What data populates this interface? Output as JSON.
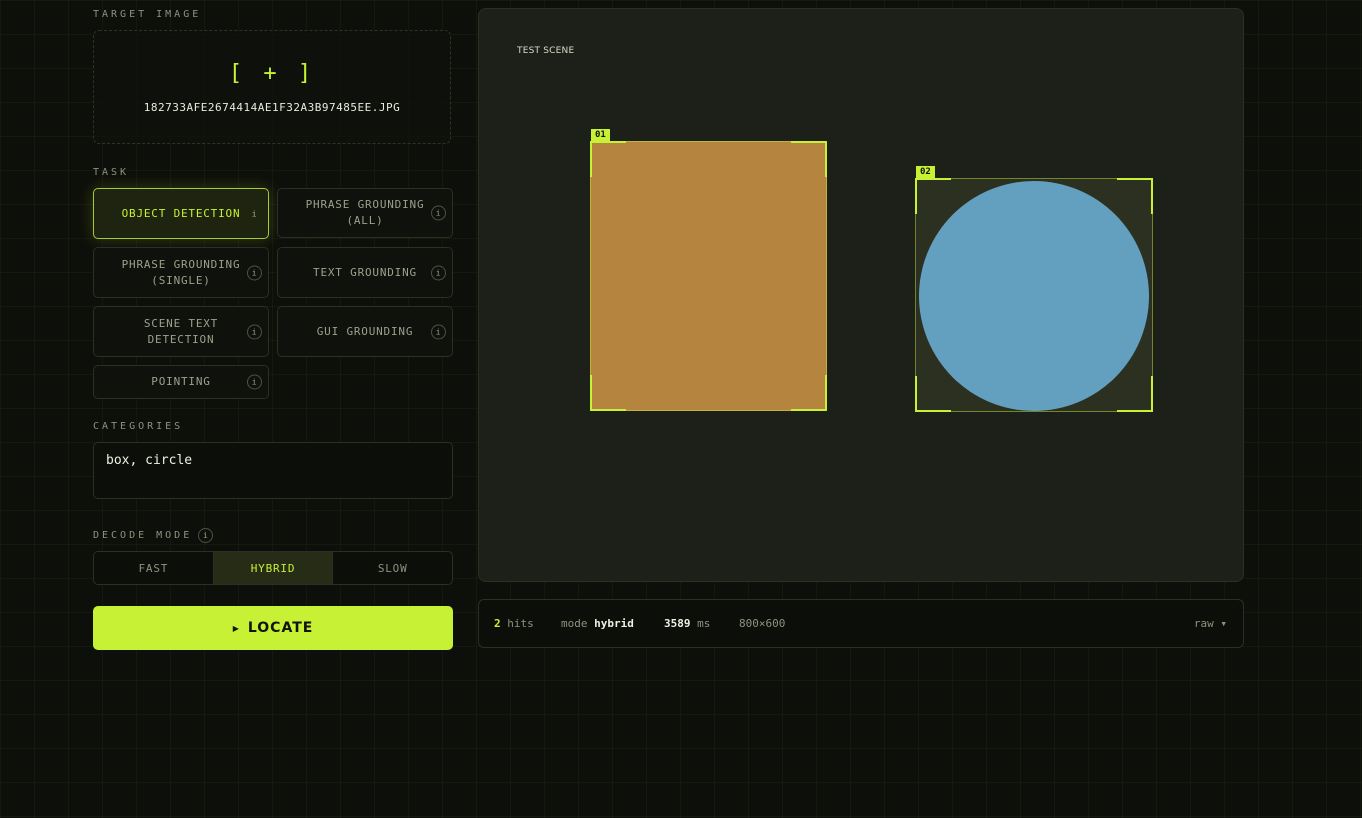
{
  "upload": {
    "label": "TARGET IMAGE",
    "icon": "[ + ]",
    "filename": "182733AFE2674414AE1F32A3B97485EE.JPG"
  },
  "task": {
    "label": "TASK",
    "options": [
      {
        "label": "OBJECT DETECTION",
        "active": true
      },
      {
        "label": "PHRASE GROUNDING (ALL)",
        "active": false
      },
      {
        "label": "PHRASE GROUNDING (SINGLE)",
        "active": false
      },
      {
        "label": "TEXT GROUNDING",
        "active": false
      },
      {
        "label": "SCENE TEXT DETECTION",
        "active": false
      },
      {
        "label": "GUI GROUNDING",
        "active": false
      },
      {
        "label": "POINTING",
        "active": false
      }
    ],
    "info_glyph": "i"
  },
  "categories": {
    "label": "CATEGORIES",
    "value": "box, circle"
  },
  "decode": {
    "label": "DECODE MODE",
    "info_glyph": "i",
    "options": [
      "FAST",
      "HYBRID",
      "SLOW"
    ],
    "selected": "HYBRID"
  },
  "locate_button": {
    "icon": "▶",
    "label": "LOCATE"
  },
  "scene": {
    "label": "TEST SCENE",
    "detections": [
      {
        "tag": "01",
        "shape": "box",
        "color": "#b5853f"
      },
      {
        "tag": "02",
        "shape": "circle",
        "color": "#63a0bf"
      }
    ]
  },
  "status": {
    "hits_count": "2",
    "hits_label": "hits",
    "mode_label": "mode",
    "mode_value": "hybrid",
    "time_value": "3589",
    "time_unit": "ms",
    "resolution": "800×600",
    "format": "raw ▾"
  },
  "colors": {
    "accent": "#c6f135",
    "background": "#0d0f0a",
    "panel": "#1d1f19"
  }
}
